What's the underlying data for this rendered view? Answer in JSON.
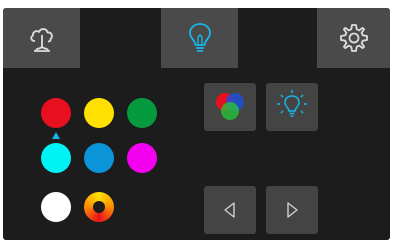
{
  "tabs": [
    {
      "id": "cloud",
      "icon": "cloud-icon"
    },
    {
      "id": "light",
      "icon": "light-bulb-icon",
      "active": true
    },
    {
      "id": "settings",
      "icon": "gear-icon"
    }
  ],
  "colors": {
    "background": "#1c1c1c",
    "tab": "#4a4a4a",
    "button": "#444444",
    "accent": "#14b7e6",
    "icon": "#dcdcdc"
  },
  "palette": [
    {
      "name": "red",
      "color": "#e8101f",
      "selected": true
    },
    {
      "name": "yellow",
      "color": "#ffe000"
    },
    {
      "name": "green",
      "color": "#069a3f"
    },
    {
      "name": "cyan",
      "color": "#00f3f4"
    },
    {
      "name": "blue",
      "color": "#0b95d8"
    },
    {
      "name": "magenta",
      "color": "#f300f0"
    },
    {
      "name": "white",
      "color": "#ffffff"
    },
    {
      "name": "color-wheel",
      "icon": "color-wheel-icon"
    }
  ],
  "buttons": [
    {
      "id": "rgb-mix",
      "icon": "rgb-circles-icon"
    },
    {
      "id": "bulb-brightness",
      "icon": "glowing-bulb-icon"
    },
    {
      "id": "previous",
      "icon": "triangle-left-icon"
    },
    {
      "id": "next",
      "icon": "triangle-right-icon"
    }
  ]
}
